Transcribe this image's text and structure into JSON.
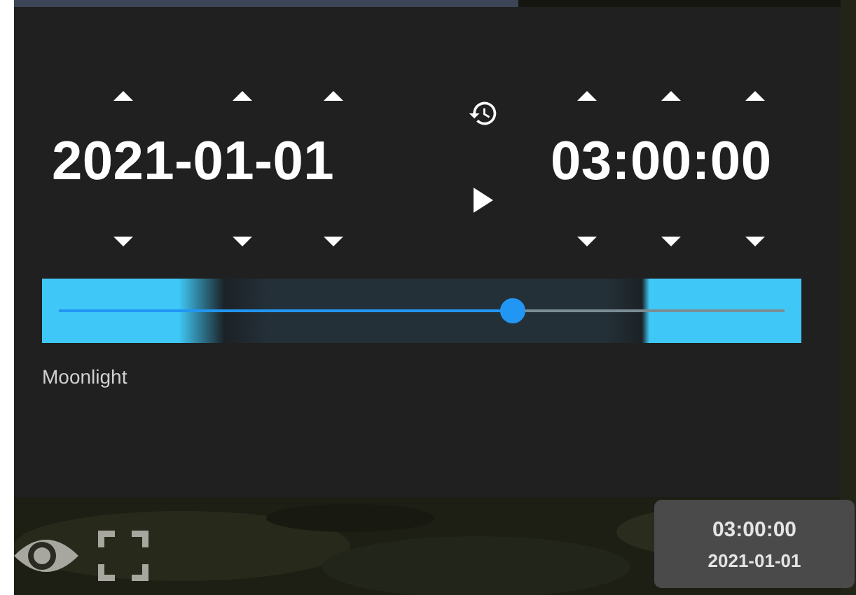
{
  "date_picker": {
    "value": "2021-01-01"
  },
  "time_picker": {
    "value": "03:00:00"
  },
  "slider": {
    "level": 0.625,
    "label": "Moonlight"
  },
  "overlay": {
    "time": "03:00:00",
    "date": "2021-01-01"
  }
}
